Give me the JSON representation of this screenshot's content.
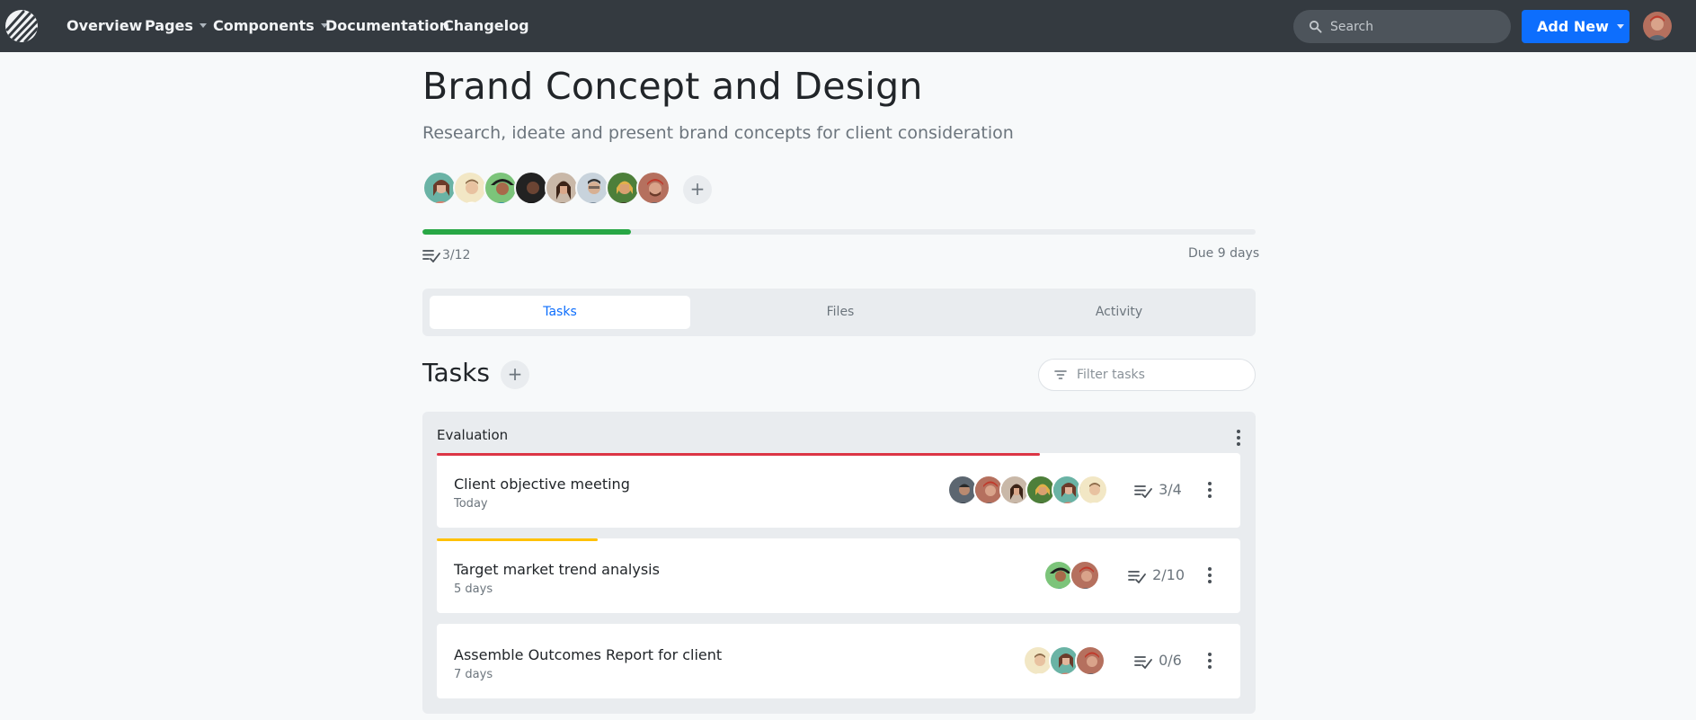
{
  "nav": {
    "links": [
      {
        "label": "Overview",
        "dropdown": false
      },
      {
        "label": "Pages",
        "dropdown": true
      },
      {
        "label": "Components",
        "dropdown": true
      },
      {
        "label": "Documentation",
        "dropdown": false
      },
      {
        "label": "Changelog",
        "dropdown": false
      }
    ],
    "search_placeholder": "Search",
    "add_new_label": "Add New"
  },
  "project": {
    "title": "Brand Concept and Design",
    "subtitle": "Research, ideate and present brand concepts for client consideration",
    "add_member_label": "+",
    "progress_fraction": 0.25,
    "task_count": "3/12",
    "due": "Due 9 days"
  },
  "tabs": [
    {
      "label": "Tasks",
      "active": true
    },
    {
      "label": "Files",
      "active": false
    },
    {
      "label": "Activity",
      "active": false
    }
  ],
  "tasks_section": {
    "title": "Tasks",
    "add_label": "+",
    "filter_placeholder": "Filter tasks"
  },
  "group": {
    "title": "Evaluation",
    "tasks": [
      {
        "name": "Client objective meeting",
        "due": "Today",
        "progress": "3/4",
        "bar_color": "#dc3545",
        "bar_fraction": 0.75
      },
      {
        "name": "Target market trend analysis",
        "due": "5 days",
        "progress": "2/10",
        "bar_color": "#ffc107",
        "bar_fraction": 0.2
      },
      {
        "name": "Assemble Outcomes Report for client",
        "due": "7 days",
        "progress": "0/6",
        "bar_color": "#e9ecef",
        "bar_fraction": 0
      }
    ]
  },
  "colors": {
    "navbar": "#343a40",
    "primary": "#0d6efd",
    "success": "#28a745",
    "danger": "#dc3545",
    "warning": "#ffc107"
  },
  "icons": [
    "logo-icon",
    "search-icon",
    "caret-down-icon",
    "checklist-icon",
    "filter-icon",
    "kebab-icon"
  ]
}
